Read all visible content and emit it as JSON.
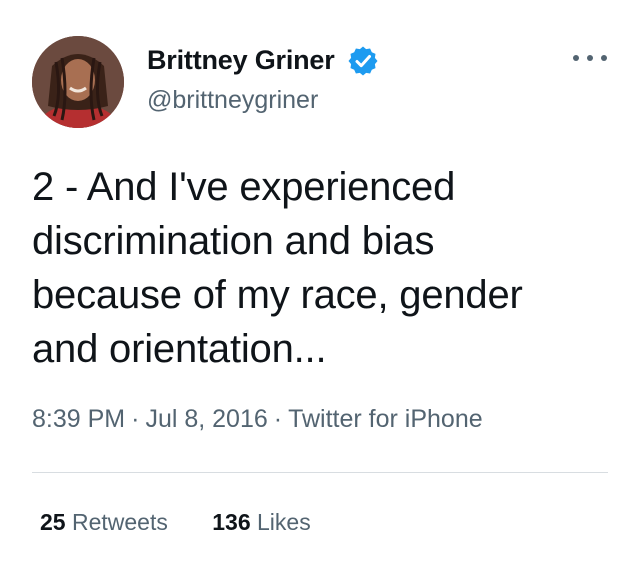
{
  "author": {
    "display_name": "Brittney Griner",
    "handle": "@brittneygriner",
    "verified": true
  },
  "tweet": {
    "lines": [
      "2 - And I've experienced",
      "discrimination and bias",
      "because of my race, gender",
      "and orientation..."
    ],
    "time": "8:39 PM",
    "date": "Jul 8, 2016",
    "source": "Twitter for iPhone",
    "separator": "·"
  },
  "stats": {
    "retweets_count": "25",
    "retweets_label": "Retweets",
    "likes_count": "136",
    "likes_label": "Likes"
  },
  "colors": {
    "text_primary": "#0f1419",
    "text_secondary": "#536471",
    "verified_blue": "#1d9bf0",
    "divider": "#d8dde1"
  },
  "icons": {
    "verified": "verified-badge-icon",
    "more": "more-options-icon"
  }
}
